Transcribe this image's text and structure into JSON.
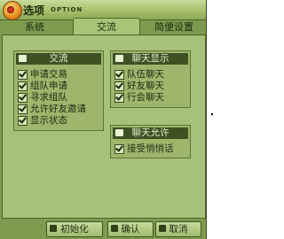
{
  "window": {
    "title": "选项",
    "title_en": "OPTION"
  },
  "tabs": [
    {
      "label": "系统",
      "active": false
    },
    {
      "label": "交流",
      "active": true
    },
    {
      "label": "简便设置",
      "active": false
    }
  ],
  "groups": {
    "communication": {
      "title": "交流",
      "items": [
        {
          "label": "申请交易",
          "checked": true
        },
        {
          "label": "组队申请",
          "checked": true
        },
        {
          "label": "寻求组队",
          "checked": true
        },
        {
          "label": "允许好友邀请",
          "checked": true
        },
        {
          "label": "显示状态",
          "checked": true
        }
      ]
    },
    "chat_display": {
      "title": "聊天显示",
      "items": [
        {
          "label": "队伍聊天",
          "checked": true
        },
        {
          "label": "好友聊天",
          "checked": true
        },
        {
          "label": "行会聊天",
          "checked": true
        }
      ]
    },
    "chat_allow": {
      "title": "聊天允许",
      "items": [
        {
          "label": "接受悄悄话",
          "checked": true
        }
      ]
    }
  },
  "buttons": {
    "reset": "初始化",
    "confirm": "确认",
    "cancel": "取消"
  },
  "colors": {
    "frame": "#7d9a4e",
    "panel": "#a7c07a",
    "header": "#3d5122"
  }
}
